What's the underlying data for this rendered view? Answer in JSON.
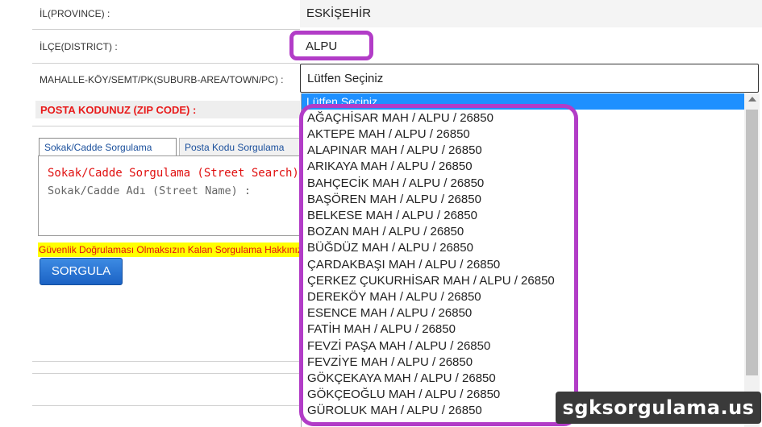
{
  "form": {
    "province_label": "İL(PROVINCE) :",
    "province_value": "ESKİŞEHİR",
    "district_label": "İLÇE(DISTRICT) :",
    "district_value": "ALPU",
    "suburb_label": "MAHALLE-KÖY/SEMT/PK(SUBURB-AREA/TOWN/PC) :",
    "suburb_selected": "Lütfen Seçiniz",
    "zip_label": "POSTA KODUNUZ (ZIP CODE) :"
  },
  "tabs": [
    {
      "label": "Sokak/Cadde Sorgulama",
      "active": true
    },
    {
      "label": "Posta Kodu Sorgulama",
      "active": false
    }
  ],
  "panel": {
    "title": "Sokak/Cadde Sorgulama (Street Search)",
    "street_label": "Sokak/Cadde Adı (Street Name) :"
  },
  "warning": "Güvenlik Doğrulaması Olmaksızın Kalan Sorgulama Hakkınız",
  "query_button": "SORGULA",
  "dropdown": {
    "highlighted": "Lütfen Seçiniz",
    "items": [
      "AĞAÇHİSAR MAH / ALPU / 26850",
      "AKTEPE MAH / ALPU / 26850",
      "ALAPINAR MAH / ALPU / 26850",
      "ARIKAYA MAH / ALPU / 26850",
      "BAHÇECİK MAH / ALPU / 26850",
      "BAŞÖREN MAH / ALPU / 26850",
      "BELKESE MAH / ALPU / 26850",
      "BOZAN MAH / ALPU / 26850",
      "BÜĞDÜZ MAH / ALPU / 26850",
      "ÇARDAKBAŞI MAH / ALPU / 26850",
      "ÇERKEZ ÇUKURHİSAR MAH / ALPU / 26850",
      "DEREKÖY MAH / ALPU / 26850",
      "ESENCE MAH / ALPU / 26850",
      "FATİH MAH / ALPU / 26850",
      "FEVZİ PAŞA MAH / ALPU / 26850",
      "FEVZİYE MAH / ALPU / 26850",
      "GÖKÇEKAYA MAH / ALPU / 26850",
      "GÖKÇEOĞLU MAH / ALPU / 26850",
      "GÜROLUK MAH / ALPU / 26850"
    ]
  },
  "watermark": "sgksorgulama.us",
  "colors": {
    "highlight": "#b23cc7",
    "selected_row": "#1e90ff",
    "error_text": "#e01010",
    "button": "#1b62c4"
  }
}
